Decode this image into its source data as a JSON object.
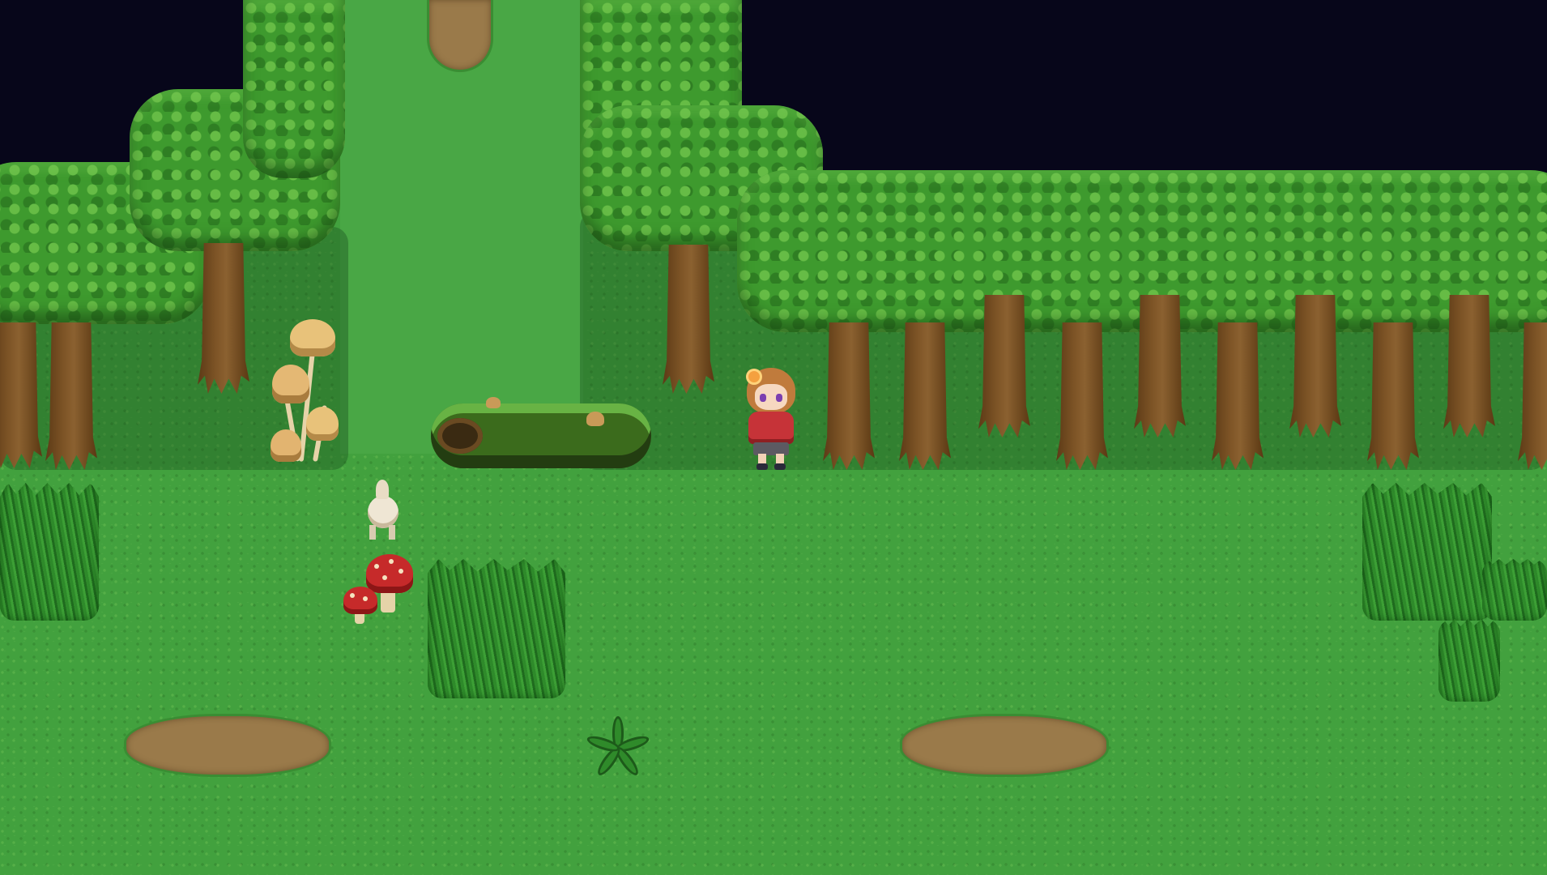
{
  "scene": {
    "type": "top-down forest clearing",
    "palette": {
      "grass": "#42a13e",
      "grass_path": "#49a745",
      "canopy": "#3e9a2e",
      "canopy_highlight": "#6ec24a",
      "trunk": "#7d5426",
      "void": "#07061a",
      "dirt": "#9a7a4a",
      "bush": "#2e8a2a"
    },
    "objects": [
      "tree-canopy",
      "tree-trunk",
      "tall-grass-bush",
      "dirt-patch",
      "mossy-log",
      "tan-mushroom-cluster",
      "red-toadstool",
      "fern",
      "small-creature",
      "player-character"
    ]
  },
  "player": {
    "name_shown": "",
    "hair_color": "#c07b3c",
    "hood_color": "#c63338",
    "eye_color": "#7b3fb0"
  }
}
